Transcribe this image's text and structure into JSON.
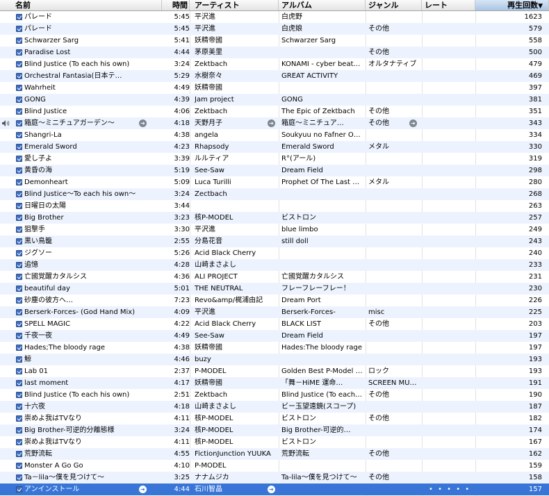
{
  "columns": {
    "name": "名前",
    "time": "時間",
    "artist": "アーティスト",
    "album": "アルバム",
    "genre": "ジャンル",
    "rating": "レート",
    "plays": "再生回数",
    "sort_indicator": "▼"
  },
  "colors": {
    "row_alt": "#edf3fe",
    "selection": "#3875d7",
    "checkbox": "#3d6dbd"
  },
  "icons": {
    "arrow": "go-arrow-icon",
    "speaker": "speaker-icon",
    "checkbox": "checkbox-checked-icon"
  },
  "now_playing_index": 9,
  "selected_index": 40,
  "selected_rating_dots": "• • • • •",
  "tracks": [
    {
      "name": "パレード",
      "time": "5:45",
      "artist": "平沢進",
      "album": "白虎野",
      "genre": "",
      "plays": "1623"
    },
    {
      "name": "パレード",
      "time": "5:45",
      "artist": "平沢進",
      "album": "白虎娘",
      "genre": "その他",
      "plays": "579"
    },
    {
      "name": "Schwarzer Sarg",
      "time": "5:41",
      "artist": "妖精帝國",
      "album": "Schwarzer Sarg",
      "genre": "",
      "plays": "558"
    },
    {
      "name": "Paradise Lost",
      "time": "4:44",
      "artist": "茅原美里",
      "album": "",
      "genre": "その他",
      "plays": "500"
    },
    {
      "name": "Blind Justice (To each his own)",
      "time": "3:24",
      "artist": "Zektbach",
      "album": "KONAMI - cyber beat…",
      "genre": "オルタナティブ",
      "plays": "479"
    },
    {
      "name": "Orchestral Fantasia(日本テ…",
      "time": "5:29",
      "artist": "水樹奈々",
      "album": "GREAT ACTIVITY",
      "genre": "",
      "plays": "469"
    },
    {
      "name": "Wahrheit",
      "time": "4:49",
      "artist": "妖精帝國",
      "album": "",
      "genre": "",
      "plays": "397"
    },
    {
      "name": "GONG",
      "time": "4:39",
      "artist": "Jam project",
      "album": "GONG",
      "genre": "",
      "plays": "381"
    },
    {
      "name": "Blind Justice",
      "time": "4:06",
      "artist": "Zektbach",
      "album": "The Epic of Zektbach",
      "genre": "その他",
      "plays": "351"
    },
    {
      "name": "箱庭～ミニチュアガーデン～",
      "time": "4:18",
      "artist": "天野月子",
      "album": "箱庭～ミニチュア…",
      "genre": "その他",
      "plays": "343"
    },
    {
      "name": "Shangri-La",
      "time": "4:38",
      "artist": "angela",
      "album": "Soukyuu no Fafner O…",
      "genre": "",
      "plays": "334"
    },
    {
      "name": "Emerald Sword",
      "time": "4:23",
      "artist": "Rhapsody",
      "album": "Emerald Sword",
      "genre": "メタル",
      "plays": "330"
    },
    {
      "name": "愛し子よ",
      "time": "3:39",
      "artist": "ルルティア",
      "album": "R°(アール)",
      "genre": "",
      "plays": "319"
    },
    {
      "name": "黄昏の海",
      "time": "5:19",
      "artist": "See-Saw",
      "album": "Dream Field",
      "genre": "",
      "plays": "298"
    },
    {
      "name": "Demonheart",
      "time": "5:09",
      "artist": "Luca Turilli",
      "album": "Prophet Of The Last …",
      "genre": "メタル",
      "plays": "280"
    },
    {
      "name": "Blind Justice～To each his own～",
      "time": "3:24",
      "artist": "Zectbach",
      "album": "",
      "genre": "",
      "plays": "268"
    },
    {
      "name": "日曜日の太陽",
      "time": "3:44",
      "artist": "",
      "album": "",
      "genre": "",
      "plays": "263"
    },
    {
      "name": "Big Brother",
      "time": "3:23",
      "artist": "核P-MODEL",
      "album": "ビストロン",
      "genre": "",
      "plays": "257"
    },
    {
      "name": "狙撃手",
      "time": "3:30",
      "artist": "平沢進",
      "album": "blue limbo",
      "genre": "",
      "plays": "249"
    },
    {
      "name": "黒い鳥籠",
      "time": "2:55",
      "artist": "分島花音",
      "album": "still doll",
      "genre": "",
      "plays": "243"
    },
    {
      "name": "ジグソー",
      "time": "5:26",
      "artist": "Acid Black Cherry",
      "album": "",
      "genre": "",
      "plays": "240"
    },
    {
      "name": "追憶",
      "time": "4:28",
      "artist": "山崎まさよし",
      "album": "",
      "genre": "",
      "plays": "233"
    },
    {
      "name": "亡國覚醒カタルシス",
      "time": "4:36",
      "artist": "ALI PROJECT",
      "album": "亡國覚醒カタルシス",
      "genre": "",
      "plays": "231"
    },
    {
      "name": "beautiful day",
      "time": "5:01",
      "artist": "THE NEUTRAL",
      "album": "フレーフレーフレー！",
      "genre": "",
      "plays": "230"
    },
    {
      "name": "砂塵の彼方へ…",
      "time": "7:23",
      "artist": "Revo&amp/梶浦由記",
      "album": "Dream Port",
      "genre": "",
      "plays": "226"
    },
    {
      "name": "Berserk-Forces- (God Hand Mix)",
      "time": "4:09",
      "artist": "平沢進",
      "album": "Berserk-Forces-",
      "genre": "misc",
      "plays": "225"
    },
    {
      "name": "SPELL MAGIC",
      "time": "4:22",
      "artist": "Acid Black Cherry",
      "album": "BLACK LIST",
      "genre": "その他",
      "plays": "203"
    },
    {
      "name": "千夜一夜",
      "time": "4:49",
      "artist": "See-Saw",
      "album": "Dream Field",
      "genre": "",
      "plays": "197"
    },
    {
      "name": "Hades;The bloody rage",
      "time": "4:38",
      "artist": "妖精帝國",
      "album": "Hades:The bloody rage",
      "genre": "",
      "plays": "197"
    },
    {
      "name": "鯨",
      "time": "4:46",
      "artist": "buzy",
      "album": "",
      "genre": "",
      "plays": "193"
    },
    {
      "name": "Lab 01",
      "time": "2:37",
      "artist": "P-MODEL",
      "album": "Golden Best P-Model …",
      "genre": "ロック",
      "plays": "193"
    },
    {
      "name": "last moment",
      "time": "4:17",
      "artist": "妖精帝國",
      "album": "「舞－HiME 運命…",
      "genre": "SCREEN MU…",
      "plays": "191"
    },
    {
      "name": "Blind Justice (To each his own)",
      "time": "2:51",
      "artist": "Zektbach",
      "album": "Blind Justice (To each…",
      "genre": "その他",
      "plays": "190"
    },
    {
      "name": "十六夜",
      "time": "4:18",
      "artist": "山崎まさよし",
      "album": "ビー玉望遠鏡(スコープ)",
      "genre": "",
      "plays": "187"
    },
    {
      "name": "崇めよ我はTVなり",
      "time": "4:11",
      "artist": "核P-MODEL",
      "album": "ビストロン",
      "genre": "その他",
      "plays": "182"
    },
    {
      "name": "Big Brother-可逆的分離態様",
      "time": "3:24",
      "artist": "核P-MODEL",
      "album": "Big Brother-可逆的…",
      "genre": "",
      "plays": "174"
    },
    {
      "name": "崇めよ我はTVなり",
      "time": "4:11",
      "artist": "核P-MODEL",
      "album": "ビストロン",
      "genre": "",
      "plays": "167"
    },
    {
      "name": "荒野流転",
      "time": "4:55",
      "artist": "FictionJunction YUUKA",
      "album": "荒野流転",
      "genre": "その他",
      "plays": "162"
    },
    {
      "name": "Monster A Go Go",
      "time": "4:10",
      "artist": "P-MODEL",
      "album": "",
      "genre": "",
      "plays": "159"
    },
    {
      "name": "Ta－lila～僕を見つけて～",
      "time": "3:25",
      "artist": "ナナムジカ",
      "album": "Ta-lila～僕を見つけて～",
      "genre": "その他",
      "plays": "158"
    },
    {
      "name": "アンインストール",
      "time": "4:44",
      "artist": "石川智晶",
      "album": "",
      "genre": "",
      "plays": "157"
    }
  ]
}
